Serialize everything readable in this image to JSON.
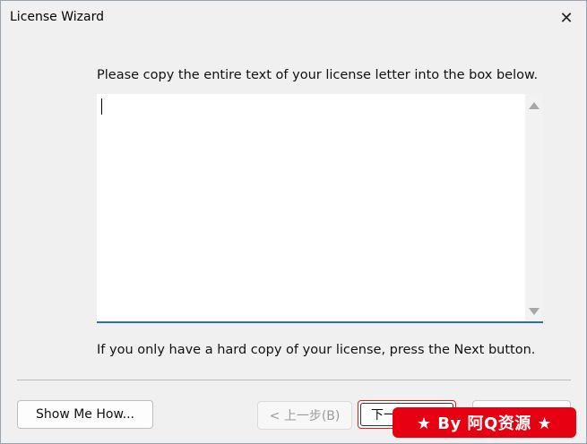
{
  "window": {
    "title": "License Wizard",
    "close_icon": "close-icon"
  },
  "prompt": "Please copy the entire text of your license letter into the box below.",
  "license_textarea": {
    "value": ""
  },
  "hint": "If you only have a hard copy of your license, press the Next button.",
  "buttons": {
    "show_me_how": "Show Me How...",
    "back": "< 上一步(B)",
    "next": "下一",
    "cancel": ""
  },
  "watermark": {
    "text": "★ By 阿Q资源 ★"
  },
  "colors": {
    "background": "#f0f0f0",
    "accent_border": "#2a6fb7",
    "highlight": "#d01f1f",
    "watermark_bg": "#e60012"
  }
}
